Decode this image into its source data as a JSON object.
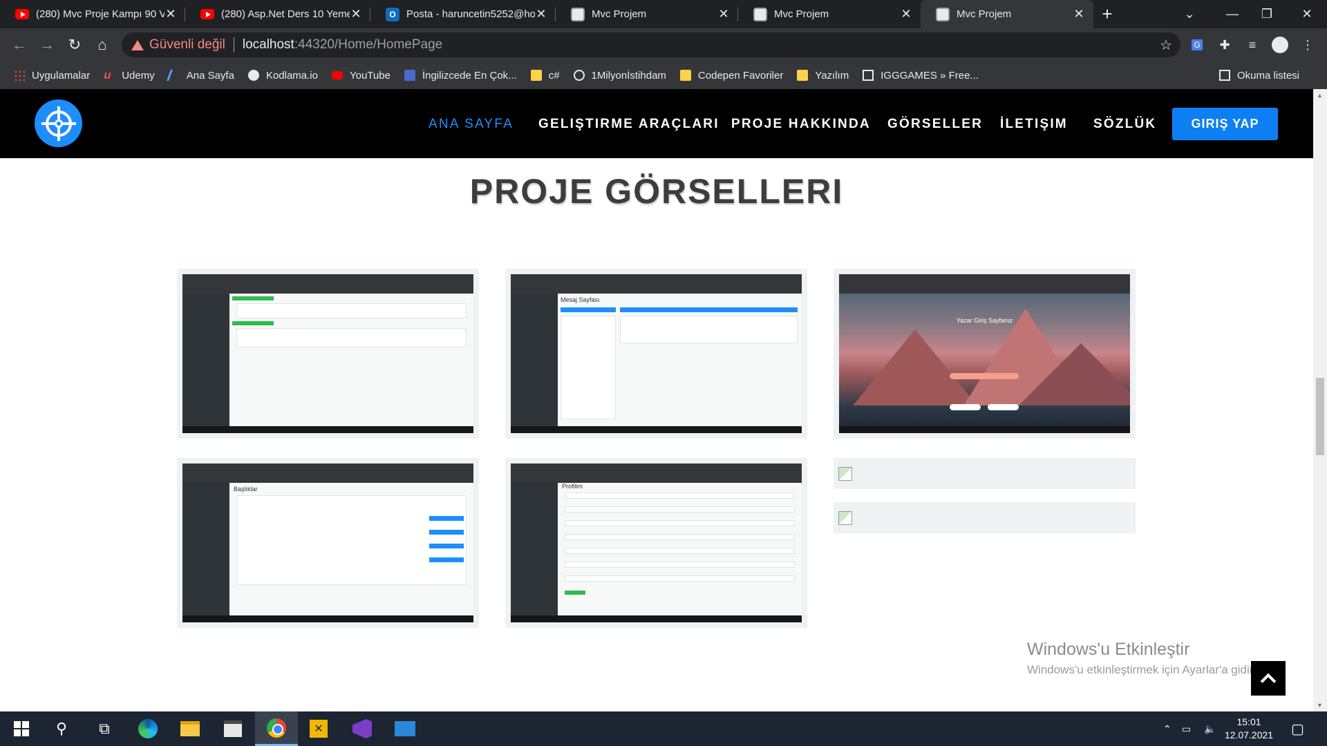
{
  "browser": {
    "tabs": [
      {
        "title": "(280) Mvc Proje Kampı 90 Vi",
        "icon": "youtube-icon"
      },
      {
        "title": "(280) Asp.Net Ders 10 Yeme",
        "icon": "youtube-icon"
      },
      {
        "title": "Posta - haruncetin5252@ho",
        "icon": "outlook-icon"
      },
      {
        "title": "Mvc Projem",
        "icon": "page-icon"
      },
      {
        "title": "Mvc Projem",
        "icon": "page-icon"
      },
      {
        "title": "Mvc Projem",
        "icon": "page-icon",
        "active": true
      }
    ],
    "address": {
      "security_label": "Güvenli değil",
      "host": "localhost",
      "rest": ":44320/Home/HomePage"
    },
    "bookmarks": [
      {
        "label": "Uygulamalar",
        "icon": "apps-grid-icon"
      },
      {
        "label": "Udemy",
        "icon": "udemy-icon"
      },
      {
        "label": "Ana Sayfa",
        "icon": "feather-icon"
      },
      {
        "label": "Kodlama.io",
        "icon": "kodlama-icon"
      },
      {
        "label": "YouTube",
        "icon": "youtube-icon"
      },
      {
        "label": "İngilizcede En Çok...",
        "icon": "graduation-icon"
      },
      {
        "label": "c#",
        "icon": "folder-icon"
      },
      {
        "label": "1Milyonİstihdam",
        "icon": "globe-icon"
      },
      {
        "label": "Codepen Favoriler",
        "icon": "folder-icon"
      },
      {
        "label": "Yazılım",
        "icon": "folder-icon"
      },
      {
        "label": "IGGGAMES » Free...",
        "icon": "page-icon"
      }
    ],
    "reading_list": "Okuma listesi"
  },
  "site": {
    "nav": [
      {
        "label": "ANA SAYFA",
        "active": true
      },
      {
        "label": "GELIŞTIRME ARAÇLARI"
      },
      {
        "label": "PROJE HAKKINDA"
      },
      {
        "label": "GÖRSELLER"
      },
      {
        "label": "İLETIŞIM"
      },
      {
        "label": "SÖZLÜK"
      }
    ],
    "login_button": "GIRIŞ YAP",
    "section_title": "PROJE GÖRSELLERI",
    "accent_color": "#1e8eff"
  },
  "screenshots": [
    {
      "label": "",
      "kind": "comments-list"
    },
    {
      "label": "Mesaj Sayfası",
      "kind": "inbox"
    },
    {
      "label": "Yazar Giriş Sayfanız",
      "kind": "login-mountain"
    },
    {
      "label": "Başlıklar",
      "kind": "table"
    },
    {
      "label": "Profilim",
      "kind": "form"
    }
  ],
  "watermark": {
    "title": "Windows'u Etkinleştir",
    "subtitle": "Windows'u etkinleştirmek için Ayarlar'a gidin."
  },
  "taskbar": {
    "time": "15:01",
    "date": "12.07.2021"
  }
}
